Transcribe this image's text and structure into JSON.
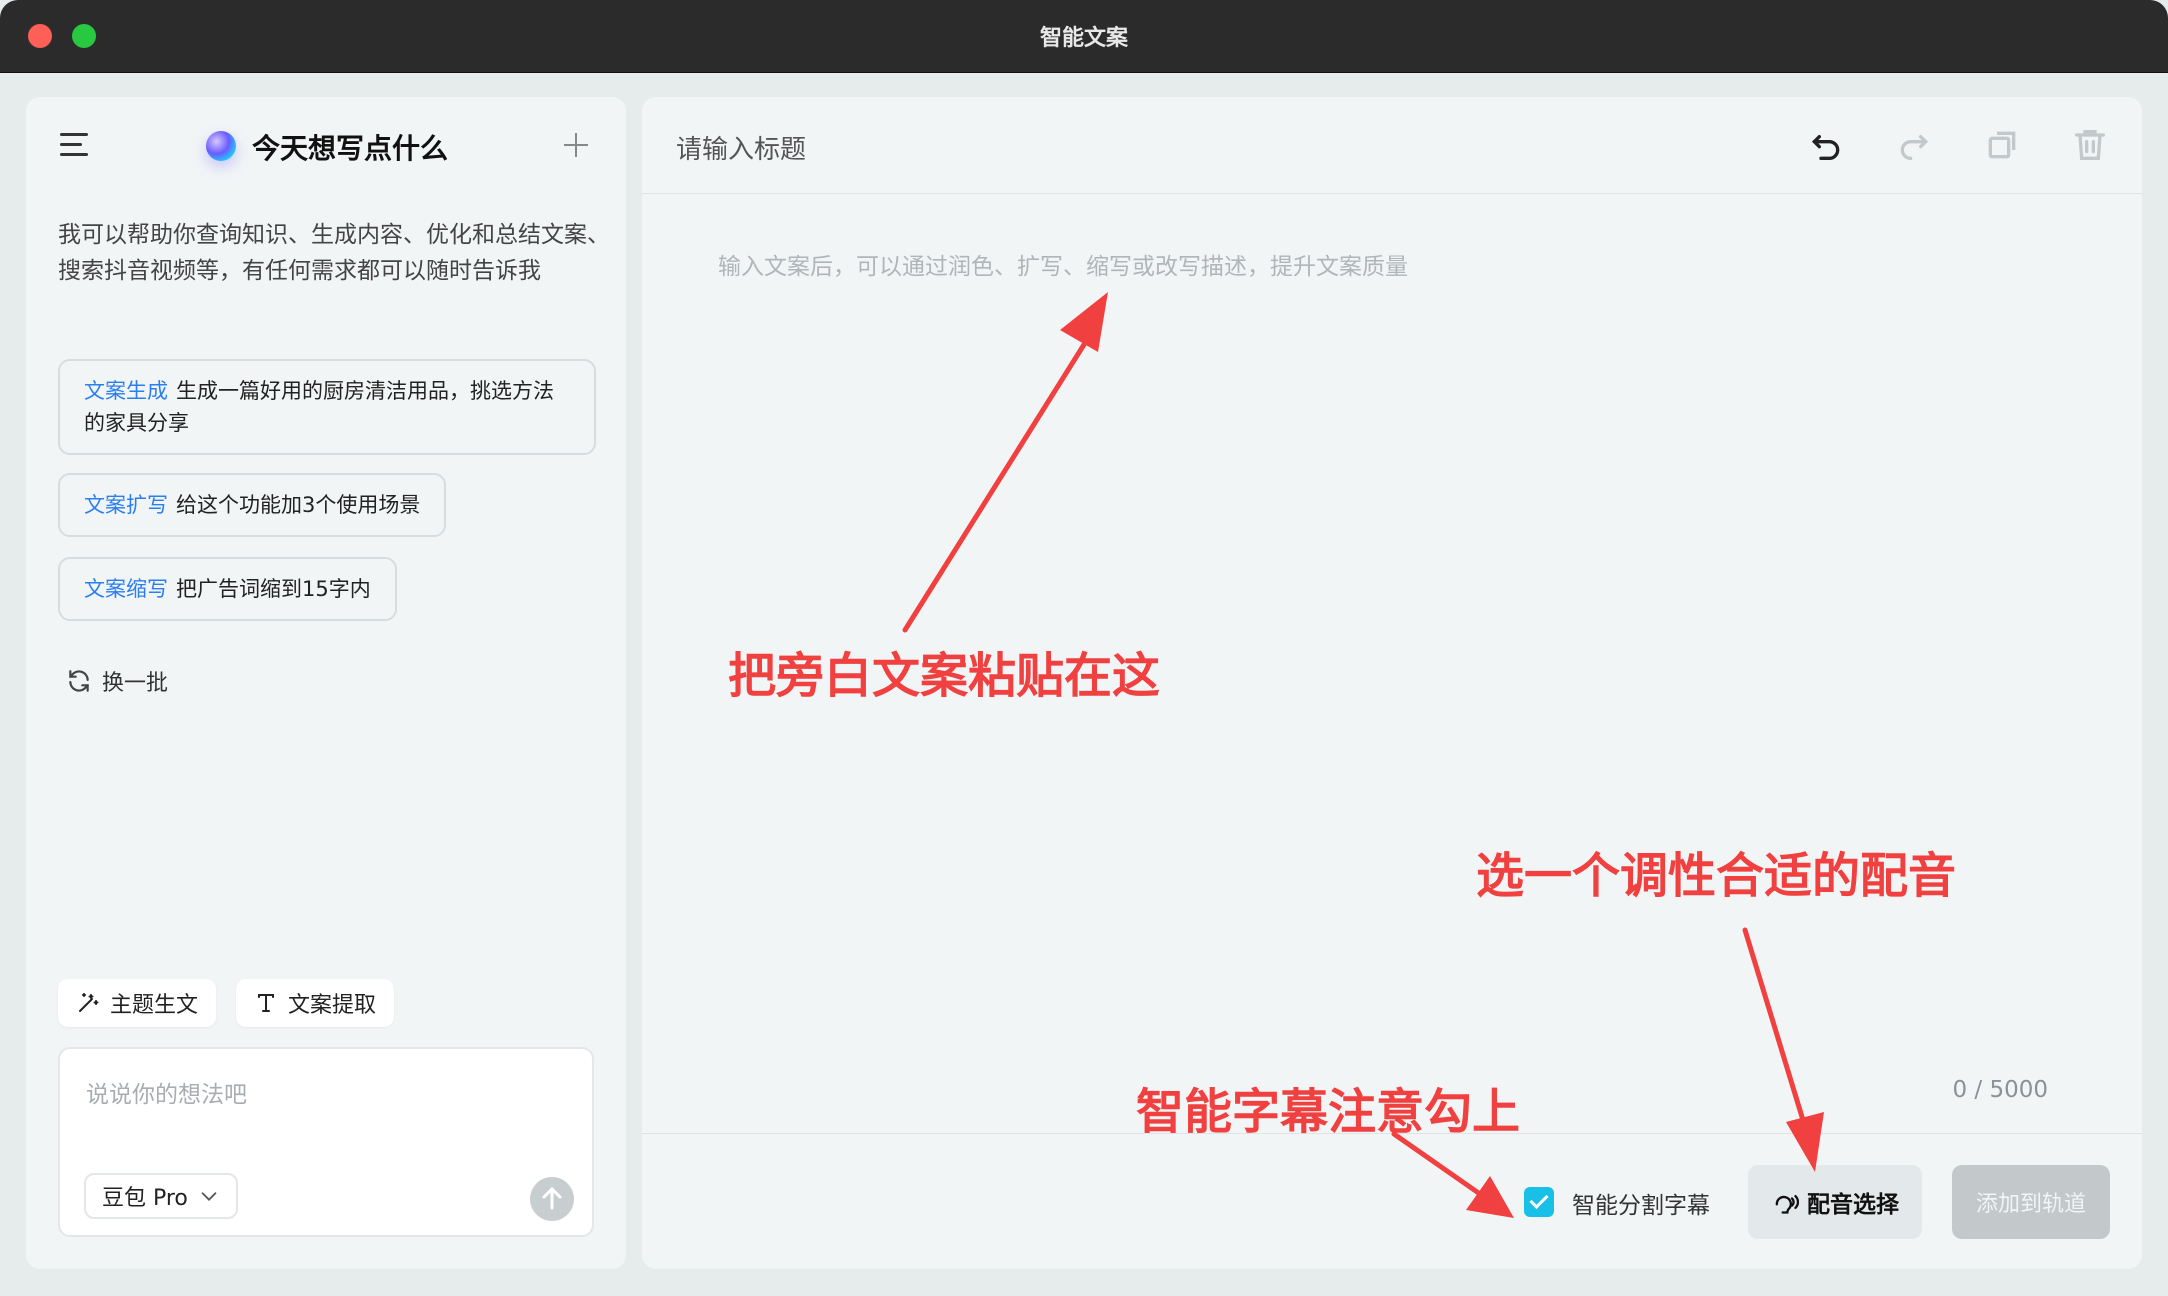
{
  "window": {
    "title": "智能文案"
  },
  "left": {
    "title": "今天想写点什么",
    "intro": "我可以帮助你查询知识、生成内容、优化和总结文案、搜索抖音视频等，有任何需求都可以随时告诉我",
    "suggestions": [
      {
        "tag": "文案生成",
        "text": "生成一篇好用的厨房清洁用品，挑选方法的家具分享"
      },
      {
        "tag": "文案扩写",
        "text": "给这个功能加3个使用场景"
      },
      {
        "tag": "文案缩写",
        "text": "把广告词缩到15字内"
      }
    ],
    "refresh_label": "换一批",
    "chips": [
      "主题生文",
      "文案提取"
    ],
    "input_placeholder": "说说你的想法吧",
    "model": "豆包 Pro"
  },
  "editor": {
    "title_placeholder": "请输入标题",
    "body_placeholder": "输入文案后，可以通过润色、扩写、缩写或改写描述，提升文案质量",
    "count": "0 / 5000",
    "smart_subtitle_label": "智能分割字幕",
    "smart_subtitle_checked": true,
    "voice_label": "配音选择",
    "add_label": "添加到轨道"
  },
  "annotations": {
    "paste": "把旁白文案粘贴在这",
    "voice": "选一个调性合适的配音",
    "subtitle": "智能字幕注意勾上"
  },
  "colors": {
    "accent": "#18c0e8",
    "annotation": "#f0403f",
    "link": "#2a7ef0"
  }
}
